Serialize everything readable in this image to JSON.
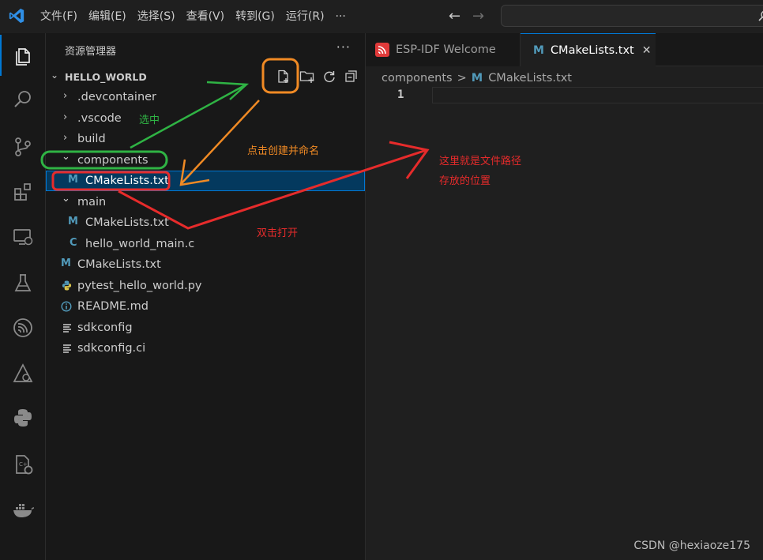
{
  "menu": [
    "文件(F)",
    "编辑(E)",
    "选择(S)",
    "查看(V)",
    "转到(G)",
    "运行(R)",
    "···"
  ],
  "explorer": {
    "title": "资源管理器",
    "more": "···",
    "workspace": "HELLO_WORLD",
    "actions": [
      "new-file",
      "new-folder",
      "refresh",
      "collapse-all"
    ],
    "tree": [
      {
        "type": "folder",
        "expanded": false,
        "label": ".devcontainer"
      },
      {
        "type": "folder",
        "expanded": false,
        "label": ".vscode"
      },
      {
        "type": "folder",
        "expanded": false,
        "label": "build"
      },
      {
        "type": "folder",
        "expanded": true,
        "label": "components"
      },
      {
        "type": "file",
        "icon": "M",
        "label": "CMakeLists.txt",
        "selected": true
      },
      {
        "type": "folder",
        "expanded": true,
        "label": "main"
      },
      {
        "type": "file",
        "icon": "M",
        "label": "CMakeLists.txt"
      },
      {
        "type": "file",
        "icon": "C",
        "label": "hello_world_main.c"
      },
      {
        "type": "file",
        "icon": "M",
        "label": "CMakeLists.txt"
      },
      {
        "type": "file",
        "icon": "py",
        "label": "pytest_hello_world.py"
      },
      {
        "type": "file",
        "icon": "info",
        "label": "README.md"
      },
      {
        "type": "file",
        "icon": "lines",
        "label": "sdkconfig"
      },
      {
        "type": "file",
        "icon": "lines",
        "label": "sdkconfig.ci"
      }
    ]
  },
  "tabs": [
    {
      "label": "ESP-IDF Welcome",
      "active": false
    },
    {
      "label": "CMakeLists.txt",
      "active": true,
      "close": "✕"
    }
  ],
  "breadcrumb": {
    "folder": "components",
    "separator": ">",
    "file": "CMakeLists.txt"
  },
  "editor": {
    "line_number": "1"
  },
  "annotations": {
    "selected": "选中",
    "click_create": "点击创建并命名",
    "path_line1": "这里就是文件路径",
    "path_line2": "存放的位置",
    "double_click": "双击打开"
  },
  "watermark": "CSDN @hexiaoze175",
  "colors": {
    "accent": "#0078d4",
    "selection": "#04395e",
    "cmake_icon": "#519aba",
    "c_icon": "#519aba",
    "green_annotation": "#2fb344",
    "orange_annotation": "#f08a24",
    "red_annotation": "#e62b2b"
  }
}
